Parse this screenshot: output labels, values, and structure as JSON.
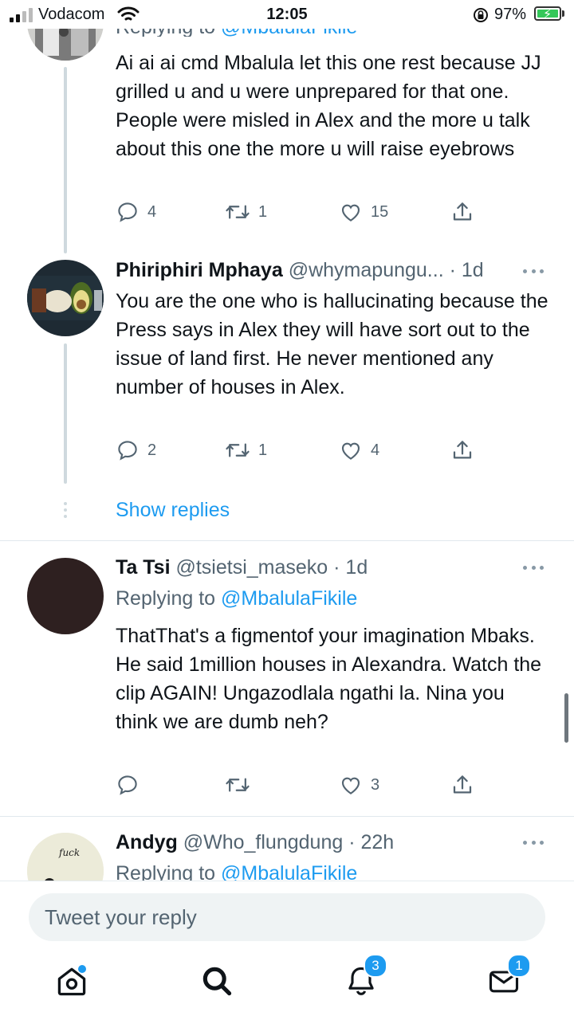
{
  "status_bar": {
    "carrier": "Vodacom",
    "time": "12:05",
    "battery_percent": "97%"
  },
  "tweets": [
    {
      "replying_prefix": "Replying to ",
      "replying_handle": "@MbalulaFikile",
      "text": "Ai ai ai cmd Mbalula let this one rest because JJ grilled u and u were unprepared for that one. People were misled in Alex and the more u talk about this one the more u will raise eyebrows",
      "replies": "4",
      "retweets": "1",
      "likes": "15"
    },
    {
      "name": "Phiriphiri Mphaya",
      "meta": "@whymapungu... · 1d",
      "text": "You are the one who is hallucinating because the Press says in Alex they will have sort out to the issue of land first.  He never mentioned any number of houses in Alex.",
      "replies": "2",
      "retweets": "1",
      "likes": "4"
    },
    {
      "name": "Ta Tsi",
      "meta": "@tsietsi_maseko · 1d",
      "replying_prefix": "Replying to ",
      "replying_handle": "@MbalulaFikile",
      "text": "ThatThat's a figmentof your imagination Mbaks. He said 1million houses in Alexandra. Watch the clip AGAIN! Ungazodlala ngathi la. Nina you think we are dumb neh?",
      "likes": "3"
    },
    {
      "name": "Andyg",
      "meta": "@Who_flungdung · 22h",
      "replying_prefix": "Replying to ",
      "replying_handle": "@MbalulaFikile",
      "avatar_text": "fuck"
    }
  ],
  "show_replies": "Show replies",
  "reply_placeholder": "Tweet your reply",
  "tab_bar": {
    "notifications_badge": "3",
    "messages_badge": "1"
  },
  "colors": {
    "accent": "#1d9bf0",
    "text": "#0f1419",
    "secondary": "#536471",
    "divider": "#e1e8ed"
  }
}
